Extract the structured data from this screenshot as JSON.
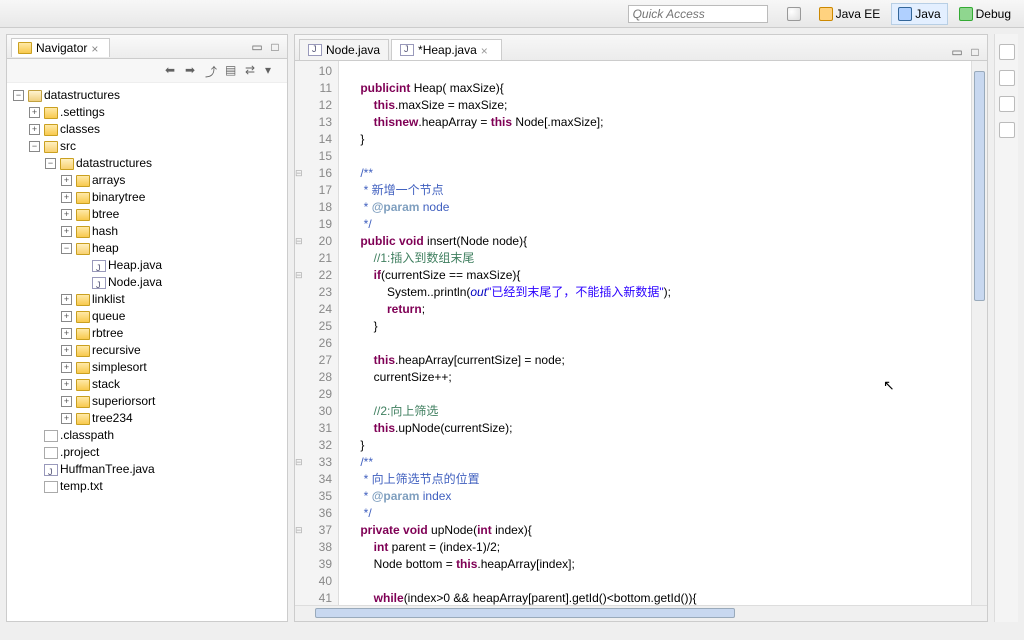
{
  "toolbar": {
    "quick_access_placeholder": "Quick Access",
    "perspectives": {
      "java_ee": "Java EE",
      "java": "Java",
      "debug": "Debug"
    }
  },
  "navigator": {
    "title": "Navigator",
    "root": "datastructures",
    "folders": {
      "settings": ".settings",
      "classes": "classes",
      "src": "src"
    },
    "src_pkg": "datastructures",
    "pkgs": [
      "arrays",
      "binarytree",
      "btree",
      "hash",
      "heap",
      "linklist",
      "queue",
      "rbtree",
      "recursive",
      "simplesort",
      "stack",
      "superiorsort",
      "tree234"
    ],
    "heap_files": [
      "Heap.java",
      "Node.java"
    ],
    "root_files": [
      ".classpath",
      ".project",
      "HuffmanTree.java",
      "temp.txt"
    ]
  },
  "editor": {
    "tabs": {
      "node": "Node.java",
      "heap": "*Heap.java"
    },
    "lines_start": 10,
    "lines_end": 41,
    "code": {
      "l10": "",
      "l11": {
        "pre": "    ",
        "kw1": "public",
        "mid": " Heap(",
        "kw2": "int",
        "post": " maxSize){"
      },
      "l12": {
        "pre": "        ",
        "kw": "this",
        "post": ".maxSize = maxSize;"
      },
      "l13": {
        "pre": "        ",
        "kw1": "this",
        "mid": ".heapArray = ",
        "kw2": "new",
        "mid2": " Node[",
        "kw3": "this",
        "post": ".maxSize];"
      },
      "l14": "    }",
      "l15": "",
      "l16": "    /**",
      "l17": "     * 新增一个节点",
      "l18": {
        "pre": "     * ",
        "tag": "@param",
        "post": " node"
      },
      "l19": "     */",
      "l20": {
        "pre": "    ",
        "kw1": "public",
        "sp": " ",
        "kw2": "void",
        "post": " insert(Node node){"
      },
      "l21": "        //1:插入到数组末尾",
      "l22": {
        "pre": "        ",
        "kw": "if",
        "post": "(currentSize == maxSize){"
      },
      "l23": {
        "pre": "            System.",
        "it": "out",
        "mid": ".println(",
        "str": "\"已经到末尾了，不能插入新数据\"",
        "post": ");"
      },
      "l24": {
        "pre": "            ",
        "kw": "return",
        "post": ";"
      },
      "l25": "        }",
      "l26": "",
      "l27": {
        "pre": "        ",
        "kw": "this",
        "post": ".heapArray[currentSize] = node;"
      },
      "l28": "        currentSize++;",
      "l29": "",
      "l30": "        //2:向上筛选",
      "l31": {
        "pre": "        ",
        "kw": "this",
        "post": ".upNode(currentSize);"
      },
      "l32": "    }",
      "l33": "    /**",
      "l34": "     * 向上筛选节点的位置",
      "l35": {
        "pre": "     * ",
        "tag": "@param",
        "post": " index"
      },
      "l36": "     */",
      "l37": {
        "pre": "    ",
        "kw1": "private",
        "sp": " ",
        "kw2": "void",
        "mid": " upNode(",
        "kw3": "int",
        "post": " index){"
      },
      "l38": {
        "pre": "        ",
        "kw": "int",
        "post": " parent = (index-1)/2;"
      },
      "l39": {
        "pre": "        Node bottom = ",
        "kw": "this",
        "post": ".heapArray[index];"
      },
      "l40": "",
      "l41": {
        "pre": "        ",
        "kw": "while",
        "post": "(index>0 && heapArray[parent].getId()<bottom.getId()){"
      }
    }
  }
}
